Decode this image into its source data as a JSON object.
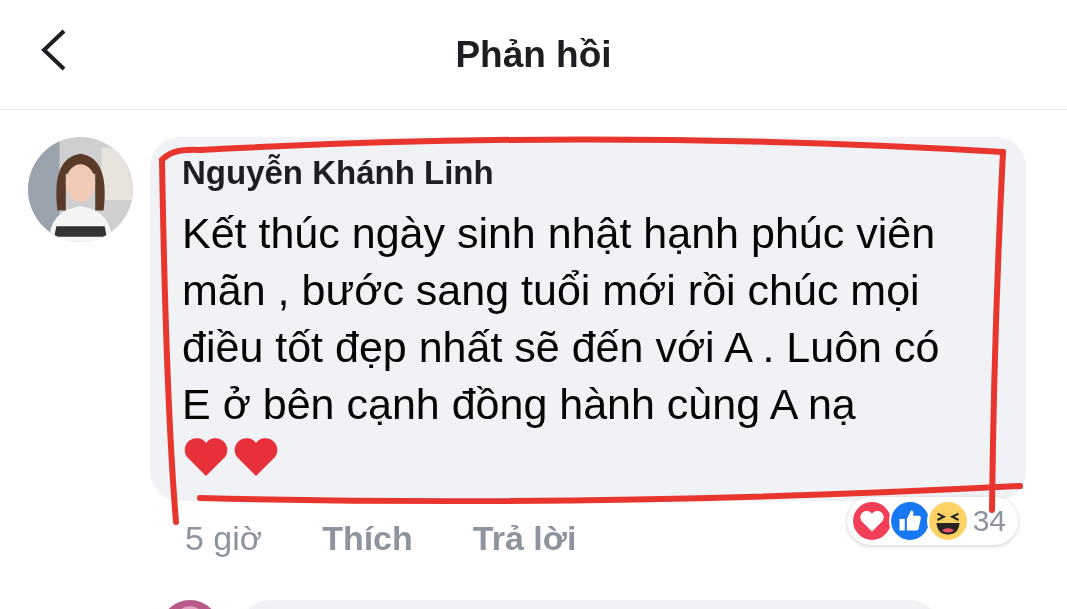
{
  "header": {
    "title": "Phản hồi"
  },
  "comment": {
    "author": "Nguyễn Khánh Linh",
    "message_lines": [
      "Kết thúc ngày sinh nhật hạnh phúc viên",
      "mãn , bước sang tuổi mới rồi chúc mọi",
      "điều tốt đẹp nhất sẽ đến với A . Luôn có",
      "E ở bên cạnh đồng hành cùng A nạ"
    ],
    "time": "5 giờ",
    "actions": [
      "Thích",
      "Trả lời"
    ],
    "reactions": [
      {
        "kind": "love"
      },
      {
        "kind": "like"
      },
      {
        "kind": "haha"
      }
    ],
    "reaction_count": "34"
  }
}
